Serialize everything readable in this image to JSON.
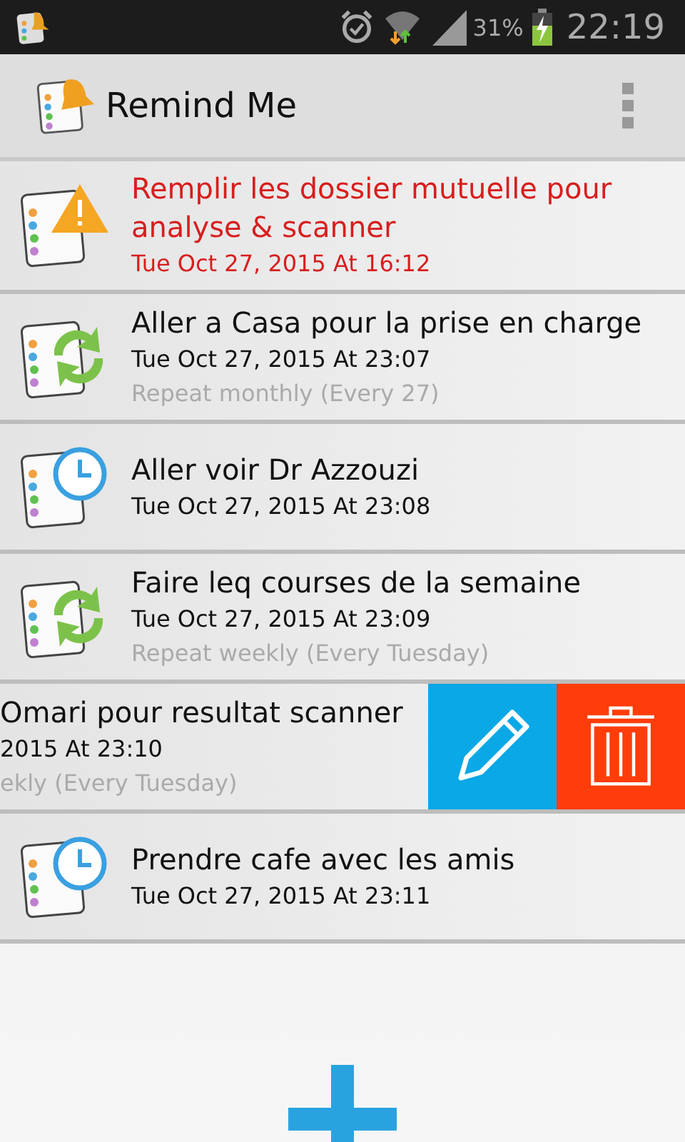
{
  "status_bar": {
    "battery": "31%",
    "time": "22:19"
  },
  "app_bar": {
    "title": "Remind Me"
  },
  "reminders": [
    {
      "kind": "warning",
      "overdue": true,
      "swiped": false,
      "title": "Remplir les dossier mutuelle pour analyse & scanner",
      "date": "Tue Oct 27, 2015 At 16:12"
    },
    {
      "kind": "repeating",
      "overdue": false,
      "swiped": false,
      "title": "Aller a Casa pour la prise en charge",
      "date": "Tue Oct 27, 2015 At 23:07",
      "repeat": "Repeat monthly (Every 27)"
    },
    {
      "kind": "single",
      "overdue": false,
      "swiped": false,
      "title": "Aller voir Dr Azzouzi",
      "date": "Tue Oct 27, 2015 At 23:08"
    },
    {
      "kind": "repeating",
      "overdue": false,
      "swiped": false,
      "title": "Faire leq courses de la semaine",
      "date": "Tue Oct 27, 2015 At 23:09",
      "repeat": "Repeat weekly (Every Tuesday)"
    },
    {
      "overdue": false,
      "swiped": true,
      "title": "Omari pour resultat scanner",
      "date": "2015 At 23:10",
      "repeat": "ekly (Every Tuesday)"
    },
    {
      "kind": "single",
      "overdue": false,
      "swiped": false,
      "title": "Prendre cafe avec les amis",
      "date": "Tue Oct 27, 2015 At 23:11"
    }
  ]
}
